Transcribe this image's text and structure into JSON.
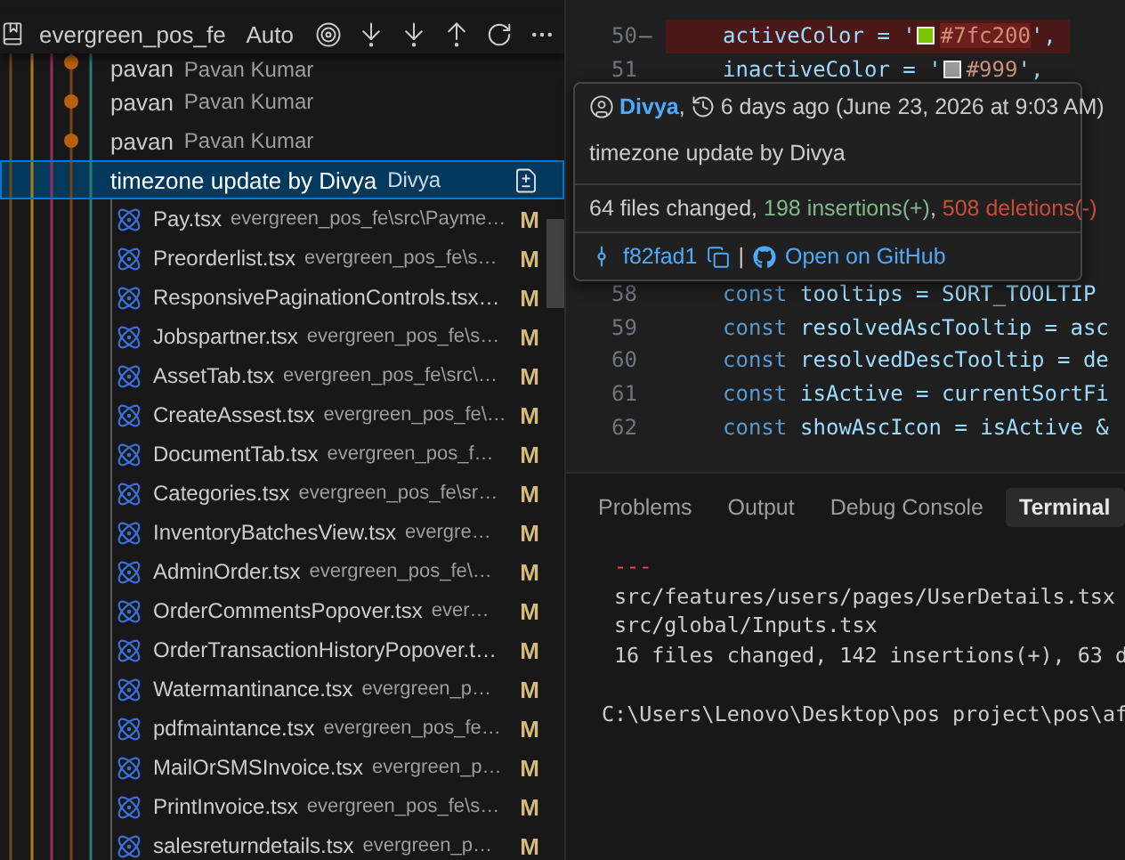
{
  "header": {
    "repo": "evergreen_pos_fe",
    "mode": "Auto"
  },
  "commits": [
    {
      "message": "pavan",
      "author": "Pavan Kumar",
      "selected": false
    },
    {
      "message": "pavan",
      "author": "Pavan Kumar",
      "selected": false
    },
    {
      "message": "pavan",
      "author": "Pavan Kumar",
      "selected": false
    },
    {
      "message": "timezone update by Divya",
      "author": "Divya",
      "selected": true
    }
  ],
  "files": [
    {
      "name": "Pay.tsx",
      "path": "evergreen_pos_fe\\src\\Payme…",
      "status": "M"
    },
    {
      "name": "Preorderlist.tsx",
      "path": "evergreen_pos_fe\\s…",
      "status": "M"
    },
    {
      "name": "ResponsivePaginationControls.tsx…",
      "status": "M"
    },
    {
      "name": "Jobspartner.tsx",
      "path": "evergreen_pos_fe\\s…",
      "status": "M"
    },
    {
      "name": "AssetTab.tsx",
      "path": "evergreen_pos_fe\\src\\…",
      "status": "M"
    },
    {
      "name": "CreateAssest.tsx",
      "path": "evergreen_pos_fe\\…",
      "status": "M"
    },
    {
      "name": "DocumentTab.tsx",
      "path": "evergreen_pos_f…",
      "status": "M"
    },
    {
      "name": "Categories.tsx",
      "path": "evergreen_pos_fe\\sr…",
      "status": "M"
    },
    {
      "name": "InventoryBatchesView.tsx",
      "path": "evergre…",
      "status": "M"
    },
    {
      "name": "AdminOrder.tsx",
      "path": "evergreen_pos_fe\\…",
      "status": "M"
    },
    {
      "name": "OrderCommentsPopover.tsx",
      "path": "ever…",
      "status": "M"
    },
    {
      "name": "OrderTransactionHistoryPopover.t…",
      "status": "M"
    },
    {
      "name": "Watermantinance.tsx",
      "path": "evergreen_p…",
      "status": "M"
    },
    {
      "name": "pdfmaintance.tsx",
      "path": "evergreen_pos_fe…",
      "status": "M"
    },
    {
      "name": "MailOrSMSInvoice.tsx",
      "path": "evergreen_p…",
      "status": "M"
    },
    {
      "name": "PrintInvoice.tsx",
      "path": "evergreen_pos_fe\\s…",
      "status": "M"
    },
    {
      "name": "salesreturndetails.tsx",
      "path": "evergreen_p…",
      "status": "M"
    }
  ],
  "editor": {
    "lines_above": [
      {
        "number": "50",
        "marker": "—",
        "kind": "color",
        "prefix": "activeColor = '",
        "color": "#7fc200",
        "value": "#7fc200",
        "suffix": "',",
        "changed": true
      },
      {
        "number": "51",
        "kind": "color",
        "prefix": "inactiveColor = '",
        "color": "#999999",
        "value": "#999",
        "suffix": "',",
        "changed": false
      }
    ],
    "lines": [
      {
        "number": "58",
        "kind": "code",
        "keyword": "const",
        "text": "tooltips = SORT_TOOLTIP",
        "changed": false
      },
      {
        "number": "59",
        "kind": "code",
        "keyword": "const",
        "text": "resolvedAscTooltip = asc",
        "changed": false
      },
      {
        "number": "60",
        "kind": "code",
        "keyword": "const",
        "text": "resolvedDescTooltip = de",
        "changed": false
      },
      {
        "number": "61",
        "kind": "code",
        "keyword": "const",
        "text": "isActive = currentSortFi",
        "changed": false
      },
      {
        "number": "62",
        "kind": "code",
        "keyword": "const",
        "text": "showAscIcon = isActive &",
        "changed": false
      }
    ]
  },
  "tooltip": {
    "author": "Divya",
    "author_suffix": ",",
    "time": "6 days ago (June 23, 2026 at 9:03 AM)",
    "message": "timezone update by Divya",
    "summary": "64 files changed, ",
    "insertions": "198 insertions(+)",
    "separator": ", ",
    "deletions": "508 deletions(-)",
    "hash": "f82fad1",
    "divider": "|",
    "link": "Open on GitHub"
  },
  "panel": {
    "tabs": [
      {
        "label": "Problems",
        "selected": false
      },
      {
        "label": "Output",
        "selected": false
      },
      {
        "label": "Debug Console",
        "selected": false
      },
      {
        "label": "Terminal",
        "selected": true
      }
    ],
    "terminal": [
      {
        "kind": "rule",
        "text": "---"
      },
      {
        "kind": "output",
        "text": "src/features/users/pages/UserDetails.tsx"
      },
      {
        "kind": "output",
        "text": "src/global/Inputs.tsx"
      },
      {
        "kind": "output",
        "text": "16 files changed, 142 insertions(+), 63 d"
      },
      {
        "kind": "prompt",
        "text": "C:\\Users\\Lenovo\\Desktop\\pos project\\pos\\af"
      }
    ]
  }
}
